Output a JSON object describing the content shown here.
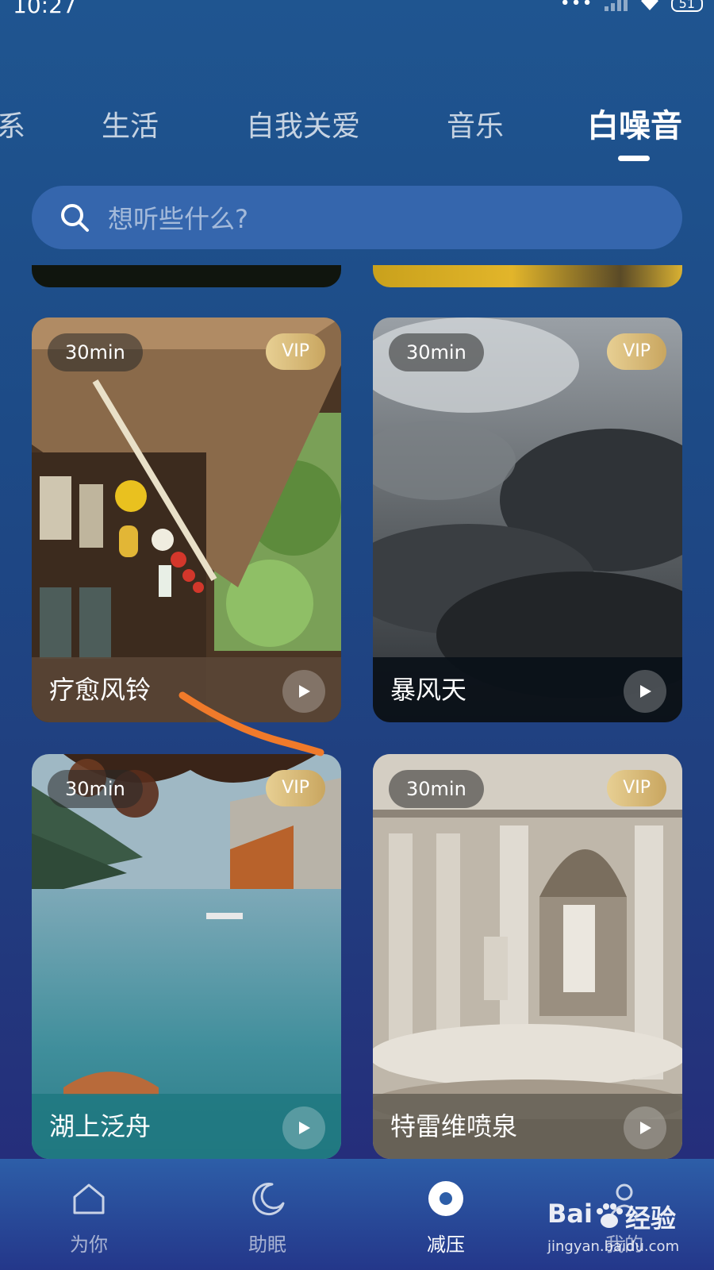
{
  "status": {
    "time": "10:27",
    "signal_dots": "•••",
    "battery": "51"
  },
  "tabs": [
    {
      "label": "系"
    },
    {
      "label": "生活"
    },
    {
      "label": "自我关爱"
    },
    {
      "label": "音乐"
    },
    {
      "label": "白噪音",
      "active": true
    }
  ],
  "search": {
    "placeholder": "想听些什么?"
  },
  "cards": [
    {
      "title": "疗愈风铃",
      "duration": "30min",
      "badge": "VIP"
    },
    {
      "title": "暴风天",
      "duration": "30min",
      "badge": "VIP"
    },
    {
      "title": "湖上泛舟",
      "duration": "30min",
      "badge": "VIP"
    },
    {
      "title": "特雷维喷泉",
      "duration": "30min",
      "badge": "VIP"
    }
  ],
  "nav": [
    {
      "label": "为你",
      "icon": "home-icon"
    },
    {
      "label": "助眠",
      "icon": "moon-icon"
    },
    {
      "label": "减压",
      "icon": "relax-icon",
      "active": true
    },
    {
      "label": "我的",
      "icon": "profile-icon"
    }
  ],
  "watermark": {
    "brand": "Bai",
    "brand2": "经验",
    "url": "jingyan.baidu.com"
  },
  "colors": {
    "accent": "#3566ad",
    "vip": "#d9bb7a",
    "annotation": "#f07a2a"
  }
}
